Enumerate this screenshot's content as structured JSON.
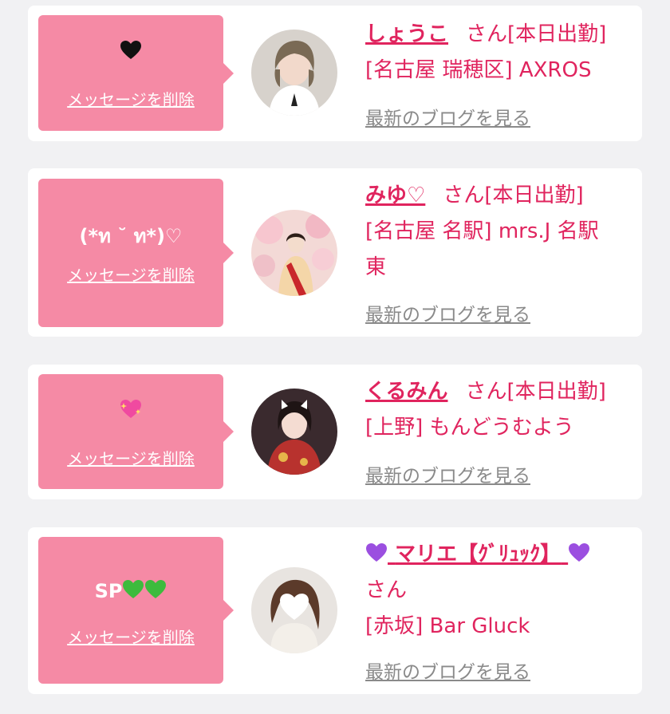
{
  "delete_label": "メッセージを削除",
  "blog_label": "最新のブログを見る",
  "san_label": "さん",
  "cards": [
    {
      "message": "🖤",
      "name": "しょうこ",
      "status": "[本日出勤]",
      "location": "[名古屋 瑞穂区] AXROS"
    },
    {
      "message": "(*ท ˘ ท*)♡",
      "name": "みゆ♡",
      "status": "[本日出勤]",
      "location_line1": "[名古屋 名駅] mrs.J 名駅",
      "location_line2": "東"
    },
    {
      "message": "💖",
      "name": "くるみん",
      "status": "[本日出勤]",
      "location": "[上野] もんどうむよう"
    },
    {
      "message_text": "SP",
      "name": "マリエ【ｸﾞﾘｭｯｸ】",
      "location": "[赤坂] Bar Gluck"
    }
  ],
  "colors": {
    "bubble": "#f58aa5",
    "accent": "#e0245e",
    "link_gray": "#8a8a8a",
    "background": "#f1f1f3",
    "heart_green": "#3dbb3d",
    "heart_purple": "#9b4fe0"
  }
}
